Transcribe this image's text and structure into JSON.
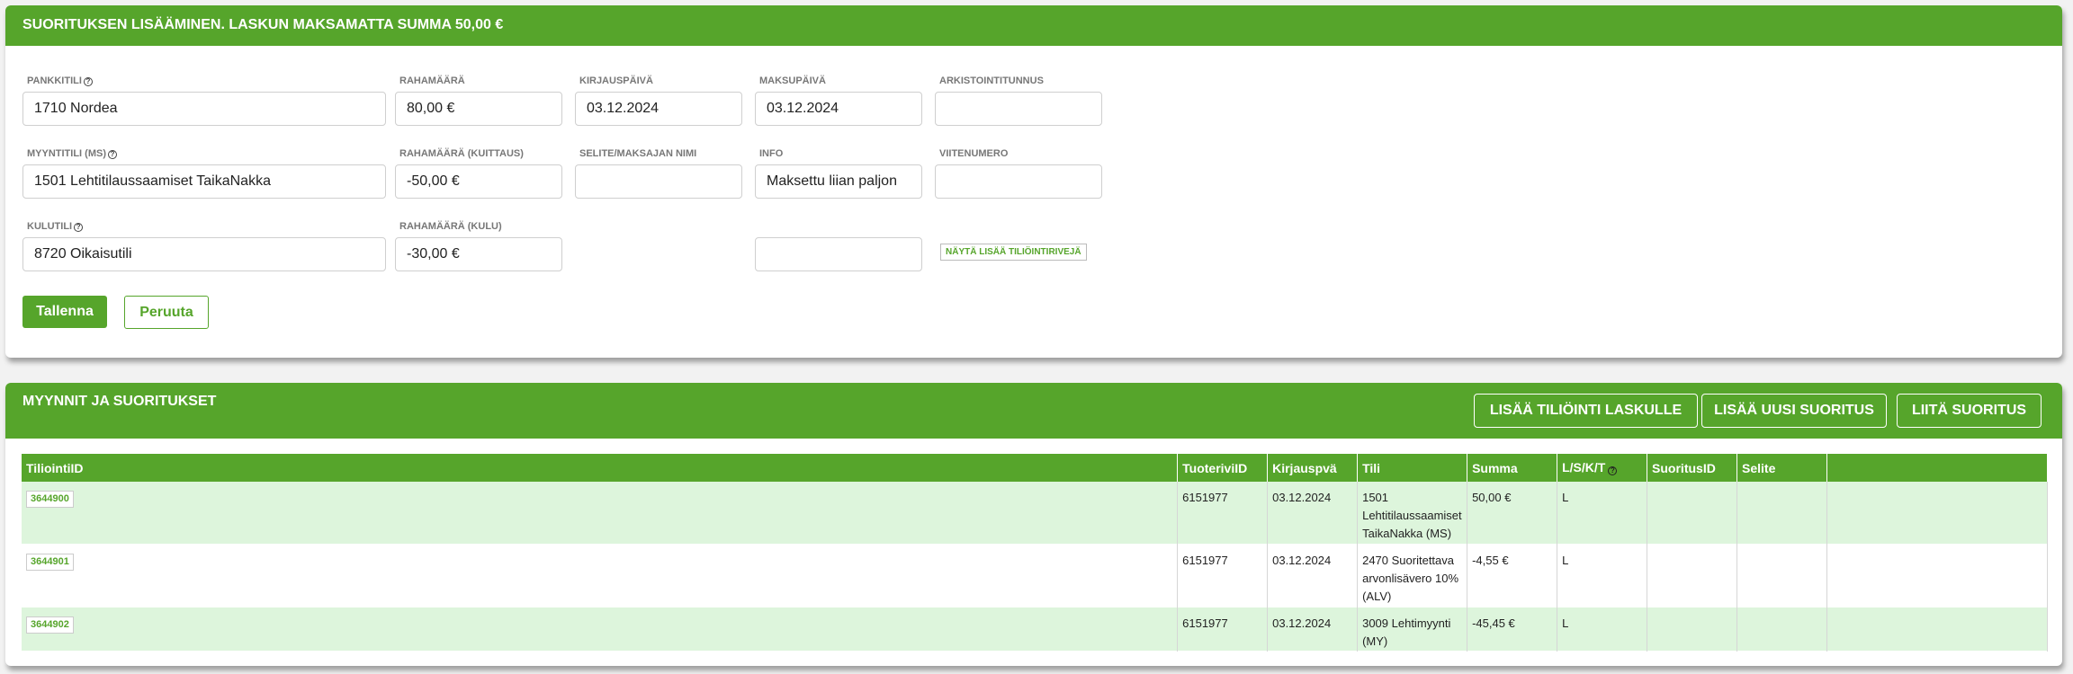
{
  "top_panel": {
    "title": "SUORITUKSEN LISÄÄMINEN. LASKUN MAKSAMATTA SUMMA 50,00 €",
    "fields": {
      "pankkitili": {
        "label": "PANKKITILI",
        "value": "1710 Nordea"
      },
      "rahamaara": {
        "label": "RAHAMÄÄRÄ",
        "value": "80,00 €"
      },
      "kirjauspaiva": {
        "label": "KIRJAUSPÄIVÄ",
        "value": "03.12.2024"
      },
      "maksupaiva": {
        "label": "MAKSUPÄIVÄ",
        "value": "03.12.2024"
      },
      "arkistointitunnus": {
        "label": "ARKISTOINTITUNNUS",
        "value": ""
      },
      "myyntitili": {
        "label": "MYYNTITILI (MS)",
        "value": "1501 Lehtitilaussaamiset TaikaNakka"
      },
      "rahamaara_kuittaus": {
        "label": "RAHAMÄÄRÄ (KUITTAUS)",
        "value": "-50,00 €"
      },
      "selite": {
        "label": "SELITE/MAKSAJAN NIMI",
        "value": ""
      },
      "info": {
        "label": "INFO",
        "value": "Maksettu liian paljon"
      },
      "viitenumero": {
        "label": "VIITENUMERO",
        "value": ""
      },
      "kulutili": {
        "label": "KULUTILI",
        "value": "8720 Oikaisutili"
      },
      "rahamaara_kulu": {
        "label": "RAHAMÄÄRÄ (KULU)",
        "value": "-30,00 €"
      },
      "extra": {
        "value": ""
      }
    },
    "show_more_link": "NÄYTÄ LISÄÄ TILIÖINTIRIVEJÄ",
    "save_label": "Tallenna",
    "cancel_label": "Peruuta"
  },
  "bottom_panel": {
    "title": "MYYNNIT JA SUORITUKSET",
    "buttons": {
      "add_posting": "LISÄÄ TILIÖINTI LASKULLE",
      "add_payment": "LISÄÄ UUSI SUORITUS",
      "attach_payment": "LIITÄ SUORITUS"
    },
    "table": {
      "headers": [
        "TiliointiID",
        "TuoteriviID",
        "Kirjauspvä",
        "Tili",
        "Summa",
        "L/S/K/T",
        "SuoritusID",
        "Selite",
        ""
      ],
      "rows": [
        {
          "id": "3644900",
          "tuoterivi": "6151977",
          "kirjauspva": "03.12.2024",
          "tili": "1501 Lehtitilaussaamiset TaikaNakka (MS)",
          "summa": "50,00 €",
          "lskt": "L",
          "suoritus": "",
          "selite": ""
        },
        {
          "id": "3644901",
          "tuoterivi": "6151977",
          "kirjauspva": "03.12.2024",
          "tili": "2470 Suoritettava arvonlisävero 10% (ALV)",
          "summa": "-4,55 €",
          "lskt": "L",
          "suoritus": "",
          "selite": ""
        },
        {
          "id": "3644902",
          "tuoterivi": "6151977",
          "kirjauspva": "03.12.2024",
          "tili": "3009 Lehtimyynti (MY)",
          "summa": "-45,45 €",
          "lskt": "L",
          "suoritus": "",
          "selite": ""
        }
      ]
    }
  },
  "colors": {
    "accent": "#56a52b",
    "row_alt": "#ddf5dc"
  },
  "icons": {
    "help": "help-circle-icon"
  }
}
